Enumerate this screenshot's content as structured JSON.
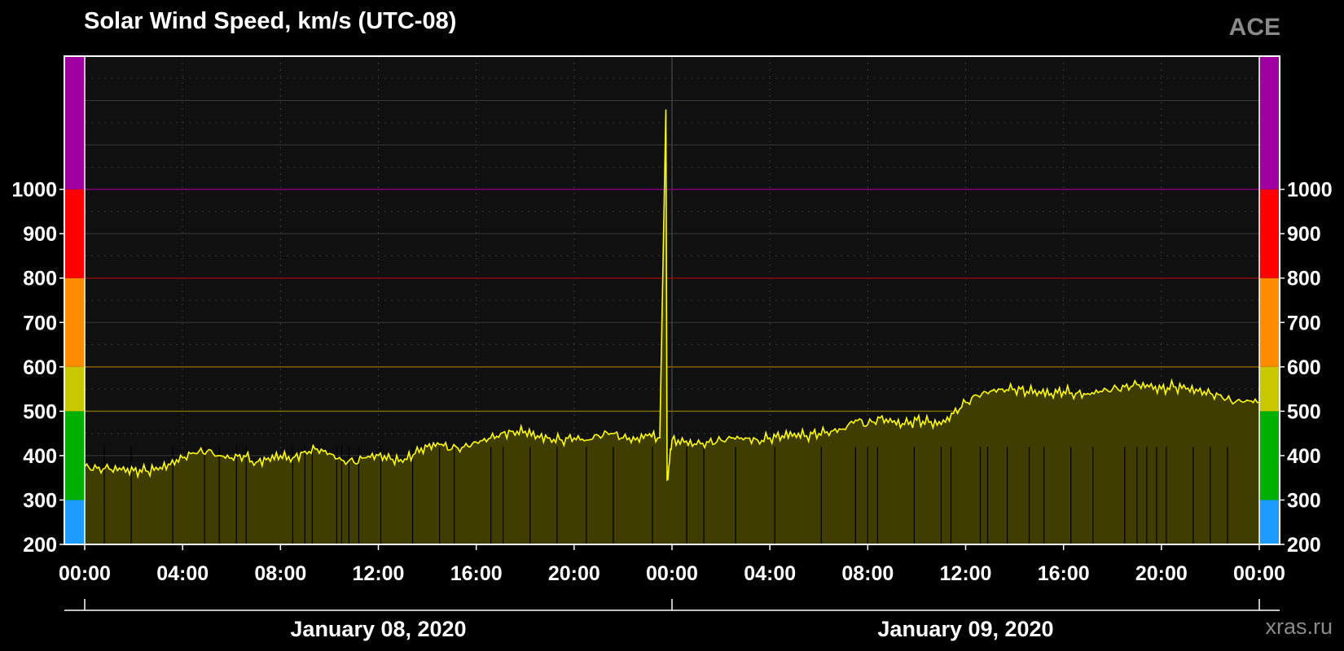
{
  "chart_data": {
    "type": "area",
    "title": "Solar Wind Speed, km/s (UTC-08)",
    "source_label": "ACE",
    "credit": "xras.ru",
    "ylim": [
      200,
      1300
    ],
    "y_ticks": [
      200,
      300,
      400,
      500,
      600,
      700,
      800,
      900,
      1000
    ],
    "x_range_hours": [
      0,
      48
    ],
    "x_tick_labels": [
      "00:00",
      "04:00",
      "08:00",
      "12:00",
      "16:00",
      "20:00",
      "00:00",
      "04:00",
      "08:00",
      "12:00",
      "16:00",
      "20:00",
      "00:00"
    ],
    "date_labels": [
      "January 08, 2020",
      "January 09, 2020"
    ],
    "grid": true,
    "threshold_lines": [
      {
        "value": 500,
        "color": "#7a6a00"
      },
      {
        "value": 600,
        "color": "#8a5a00"
      },
      {
        "value": 800,
        "color": "#8a0a0a"
      },
      {
        "value": 1000,
        "color": "#800080"
      }
    ],
    "scale_bands": [
      {
        "from": 200,
        "to": 300,
        "color": "#1e9bff"
      },
      {
        "from": 300,
        "to": 500,
        "color": "#00b000"
      },
      {
        "from": 500,
        "to": 600,
        "color": "#c8c800"
      },
      {
        "from": 600,
        "to": 800,
        "color": "#ff8c00"
      },
      {
        "from": 800,
        "to": 1000,
        "color": "#ff0000"
      },
      {
        "from": 1000,
        "to": 1300,
        "color": "#a000a0"
      }
    ],
    "series": [
      {
        "line_color": "#ffff00",
        "fill_color": "#403d00",
        "x": [
          0,
          0.5,
          1,
          1.5,
          2,
          2.5,
          3,
          3.5,
          4,
          4.5,
          5,
          5.5,
          6,
          6.5,
          7,
          7.5,
          8,
          8.5,
          9,
          9.5,
          10,
          10.5,
          11,
          11.5,
          12,
          12.5,
          13,
          13.5,
          14,
          14.5,
          15,
          15.5,
          16,
          16.5,
          17,
          17.5,
          18,
          18.5,
          19,
          19.5,
          20,
          20.5,
          21,
          21.5,
          22,
          22.5,
          23,
          23.5,
          23.75,
          23.8,
          24,
          24.5,
          25,
          25.5,
          26,
          26.5,
          27,
          27.5,
          28,
          28.5,
          29,
          29.5,
          30,
          30.5,
          31,
          31.5,
          32,
          32.5,
          33,
          33.5,
          34,
          34.5,
          35,
          35.5,
          36,
          36.5,
          37,
          37.5,
          38,
          38.5,
          39,
          39.5,
          40,
          40.5,
          41,
          41.5,
          42,
          42.5,
          43,
          43.5,
          44,
          44.5,
          45,
          45.5,
          46,
          46.5,
          47,
          47.5,
          48
        ],
        "y": [
          375,
          372,
          370,
          368,
          366,
          365,
          368,
          380,
          395,
          405,
          410,
          400,
          395,
          400,
          385,
          395,
          400,
          395,
          410,
          415,
          405,
          390,
          385,
          395,
          400,
          392,
          385,
          405,
          420,
          425,
          415,
          420,
          430,
          438,
          450,
          455,
          455,
          445,
          440,
          435,
          440,
          435,
          445,
          450,
          440,
          435,
          445,
          440,
          1180,
          345,
          435,
          430,
          425,
          430,
          435,
          440,
          440,
          435,
          440,
          445,
          450,
          445,
          450,
          455,
          460,
          480,
          470,
          485,
          475,
          470,
          480,
          475,
          470,
          495,
          520,
          535,
          545,
          550,
          550,
          545,
          545,
          540,
          545,
          540,
          540,
          545,
          550,
          555,
          560,
          555,
          550,
          555,
          550,
          545,
          540,
          530,
          520,
          525,
          520
        ],
        "dropouts_hours": [
          0.8,
          1.9,
          3.6,
          4.9,
          5.5,
          6.2,
          6.6,
          8.5,
          9.0,
          9.3,
          10.3,
          10.5,
          10.8,
          11.2,
          12.1,
          13.4,
          14.5,
          15.1,
          16.6,
          17.1,
          18.2,
          19.3,
          20.5,
          21.6,
          23.2,
          24.6,
          25.3,
          26.6,
          28.2,
          30.1,
          31.5,
          32.0,
          32.4,
          33.9,
          35.0,
          35.4,
          36.6,
          36.9,
          37.7,
          38.6,
          39.2,
          40.3,
          41.2,
          42.5,
          43.0,
          43.4,
          43.8,
          44.2,
          45.3,
          46.0,
          46.7
        ]
      }
    ]
  }
}
